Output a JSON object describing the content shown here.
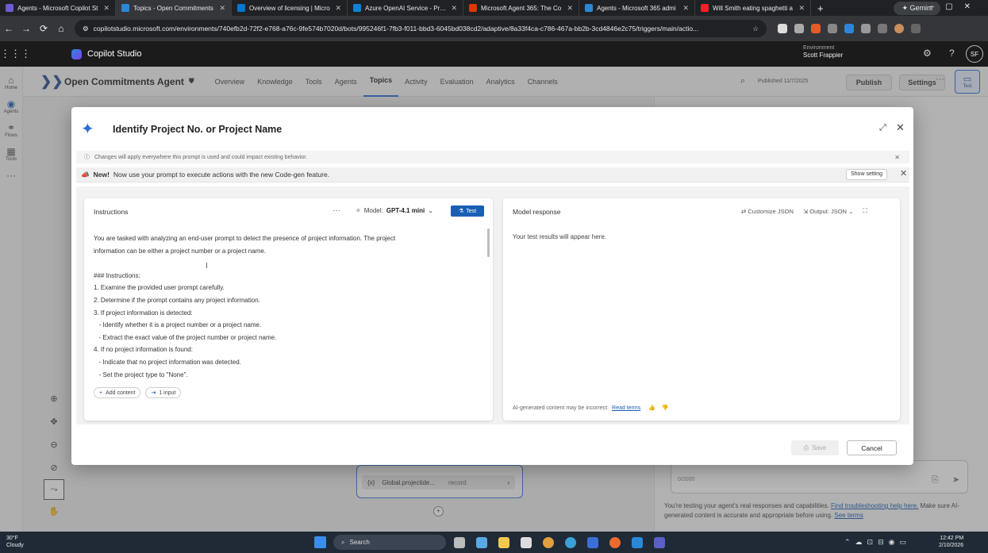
{
  "browser": {
    "tabs": [
      {
        "title": "Agents - Microsoft Copilot St",
        "color": "#6b5bd6"
      },
      {
        "title": "Topics - Open Commitments",
        "color": "#2b88d8",
        "active": true
      },
      {
        "title": "Overview of licensing | Micro",
        "color": "#0078d4"
      },
      {
        "title": "Azure OpenAI Service - Pricin",
        "color": "#0a84d8"
      },
      {
        "title": "Microsoft Agent 365: The Co",
        "color": "#d83b01"
      },
      {
        "title": "Agents - Microsoft 365 admi",
        "color": "#2b88d8"
      },
      {
        "title": "Will Smith eating spaghetti a",
        "color": "#e22"
      }
    ],
    "gemini_label": "Gemini",
    "url": "copilotstudio.microsoft.com/environments/740efb2d-72f2-e768-a76c-9fe574b7020d/bots/995246f1-7fb3-f011-bbd3-6045bd038cd2/adaptive/8a33f4ca-c786-467a-bb2b-3cd4846e2c75/triggers/main/actio..."
  },
  "app": {
    "name": "Copilot Studio",
    "environment_label": "Environment",
    "environment_name": "Scott Frappier",
    "avatar_initials": "SF"
  },
  "rail": [
    {
      "label": "Home",
      "icon": "home-icon"
    },
    {
      "label": "Agents",
      "icon": "agents-icon"
    },
    {
      "label": "Flows",
      "icon": "flows-icon"
    },
    {
      "label": "Tools",
      "icon": "tools-icon"
    }
  ],
  "agent": {
    "name": "Open Commitments Agent",
    "nav": [
      "Overview",
      "Knowledge",
      "Tools",
      "Agents",
      "Topics",
      "Activity",
      "Evaluation",
      "Analytics",
      "Channels"
    ],
    "current_nav": "Topics",
    "published": "Published 11/7/2025",
    "publish_label": "Publish",
    "settings_label": "Settings",
    "test_label": "Test"
  },
  "canvas": {
    "var_name": "Global.projectide...",
    "var_type": "record"
  },
  "test_pane": {
    "input_placeholder": "0/2000",
    "note_prefix": "You're testing your agent's real responses and capabilities.",
    "note_link": "Find troubleshooting help here.",
    "note_mid": "Make sure AI-generated content is accurate and appropriate before using.",
    "note_link2": "See terms"
  },
  "dialog": {
    "title": "Identify Project No. or Project Name",
    "banner_info": "Changes will apply everywhere this prompt is used and could impact existing behavior.",
    "banner_new_bold": "New!",
    "banner_new_text": "Now use your prompt to execute actions with the new Code-gen feature.",
    "show_setting": "Show setting",
    "instructions_label": "Instructions",
    "model_label": "Model:",
    "model_value": "GPT-4.1 mini",
    "test_button": "Test",
    "instructions": [
      "You are tasked with analyzing an end-user prompt to detect the presence of project information. The project",
      "information can be either a project number or a project name.",
      "",
      "### Instructions:",
      "1. Examine the provided user prompt carefully.",
      "2. Determine if the prompt contains any project information.",
      "3. If project information is detected:",
      "   - Identify whether it is a project number or a project name.",
      "   - Extract the exact value of the project number or project name.",
      "4. If no project information is found:",
      "   - Indicate that no project information was detected.",
      "   - Set the project type to \"None\"."
    ],
    "add_content": "Add content",
    "input_chip": "1 input",
    "response_label": "Model response",
    "customize_json": "Customize JSON",
    "output_label": "Output:",
    "output_value": "JSON",
    "response_placeholder": "Your test results will appear here.",
    "ai_disclaimer": "AI-generated content may be incorrect.",
    "read_terms": "Read terms",
    "save_label": "Save",
    "cancel_label": "Cancel"
  },
  "taskbar": {
    "temp": "30°F",
    "weather": "Cloudy",
    "search": "Search",
    "time": "12:42 PM",
    "date": "2/10/2026"
  }
}
